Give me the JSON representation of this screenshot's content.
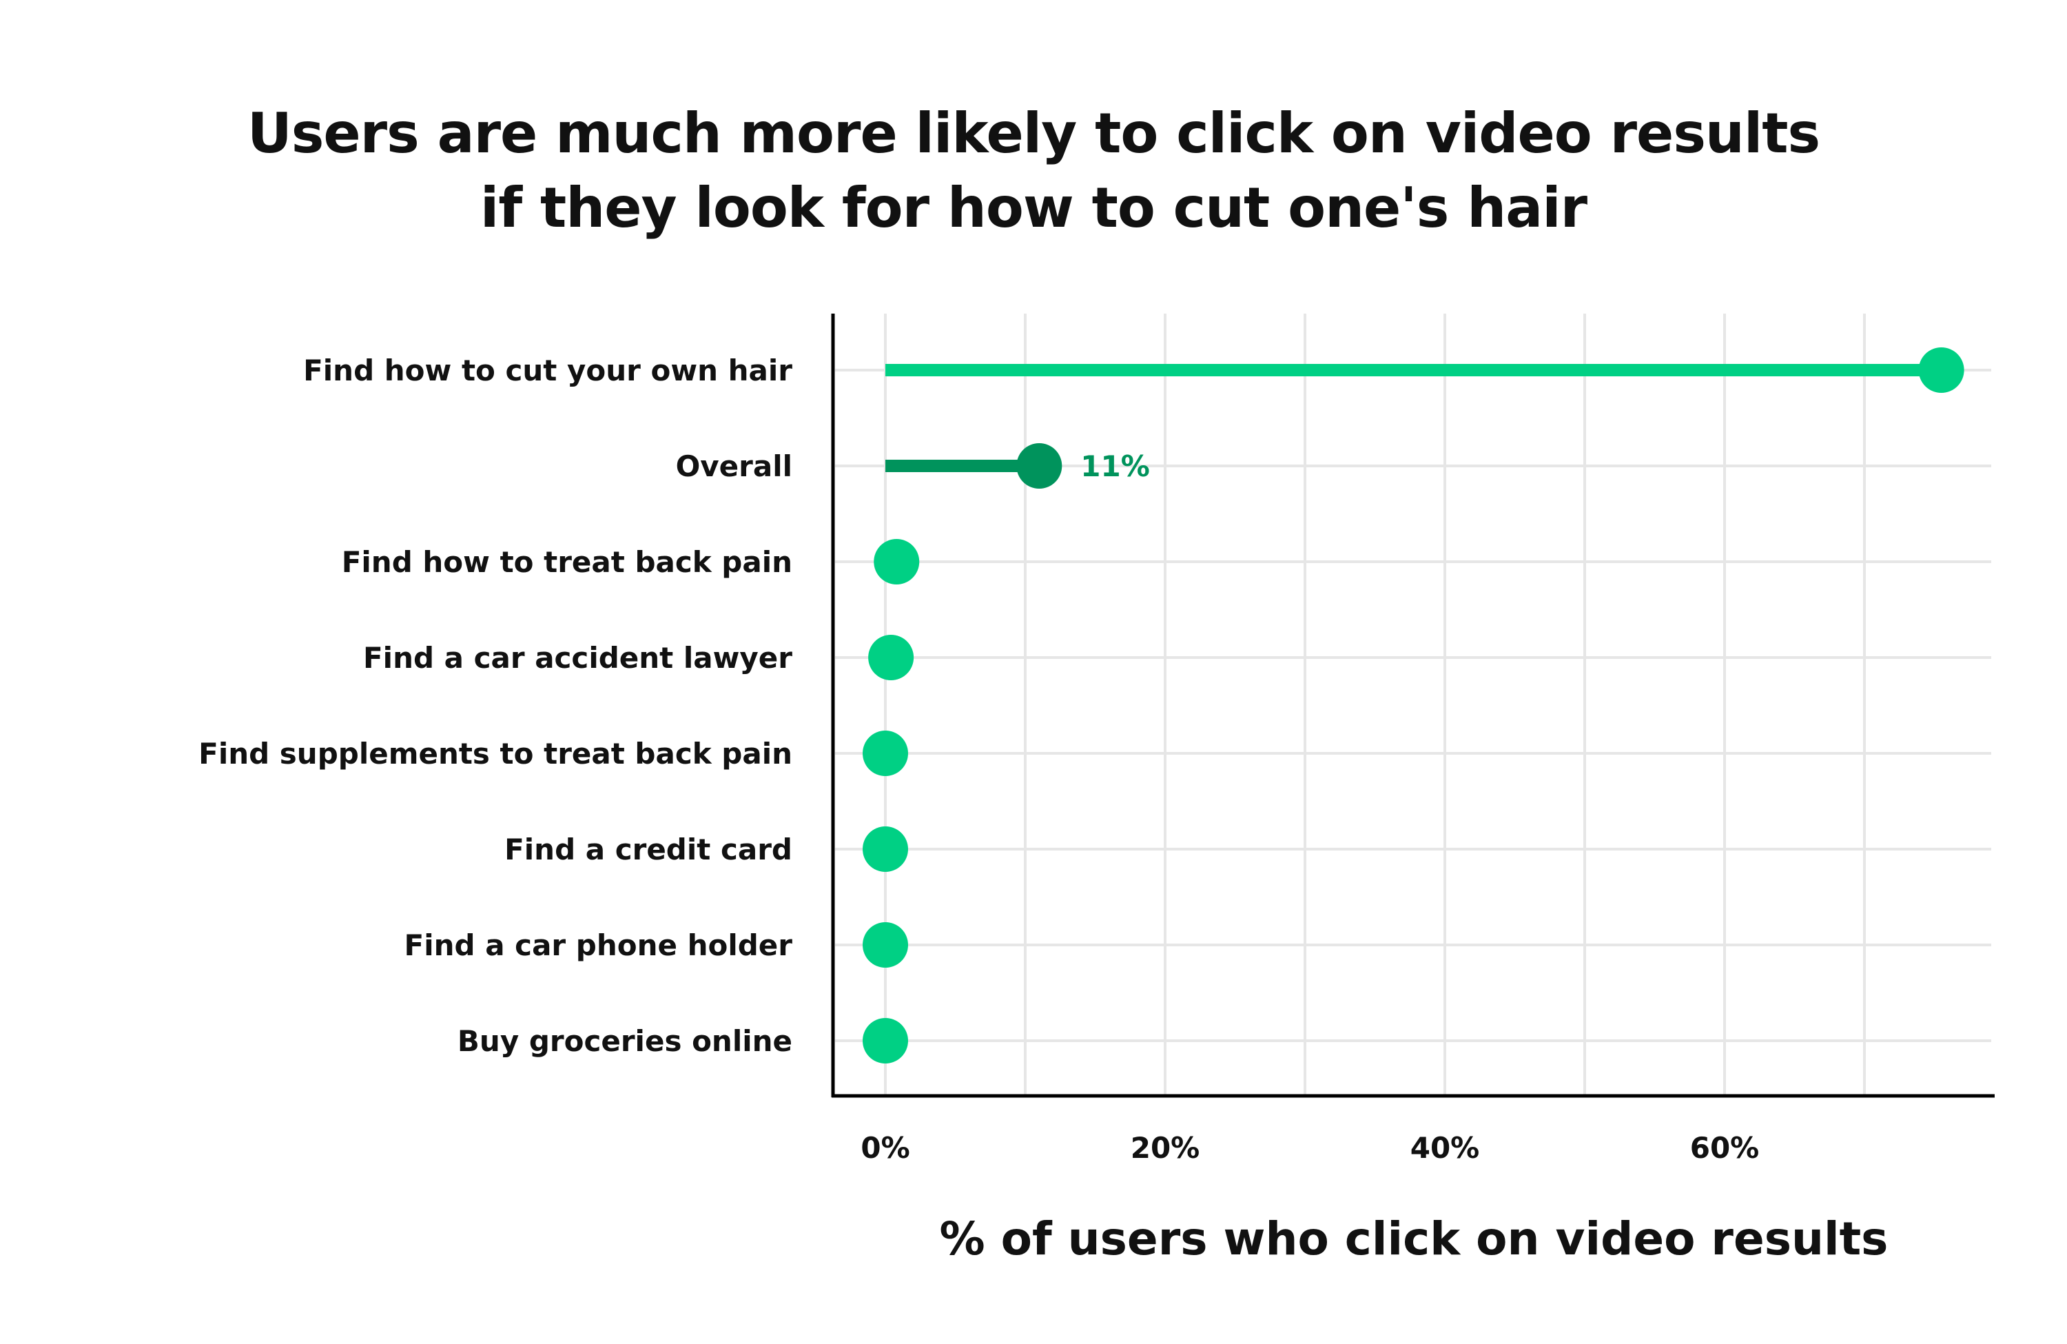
{
  "title_lines": [
    "Users are much more likely to click on video results",
    "if they look for how to cut one's hair"
  ],
  "chart_data": {
    "type": "lollipop",
    "title": "Users are much more likely to click on video results if they look for how to cut one's hair",
    "xlabel": "% of users who click on video results",
    "ylabel": "",
    "xlim": [
      0,
      80
    ],
    "x_ticks": [
      "0%",
      "20%",
      "40%",
      "60%"
    ],
    "x_tick_values": [
      0,
      20,
      40,
      60
    ],
    "grid": true,
    "categories": [
      "Find how to cut your own hair",
      "Overall",
      "Find how to treat back pain",
      "Find a car accident lawyer",
      "Find supplements to treat back pain",
      "Find a credit card",
      "Find a car phone holder",
      "Buy groceries online"
    ],
    "values": [
      75.5,
      11,
      0.8,
      0.4,
      0,
      0,
      0,
      0
    ],
    "highlight_index": 1,
    "data_labels": [
      {
        "category": "Overall",
        "text": "11%"
      }
    ],
    "colors": {
      "primary": "#00d084",
      "highlight": "#00935c",
      "label": "#00935c",
      "grid": "#e6e6e6",
      "axis": "#000000"
    }
  }
}
